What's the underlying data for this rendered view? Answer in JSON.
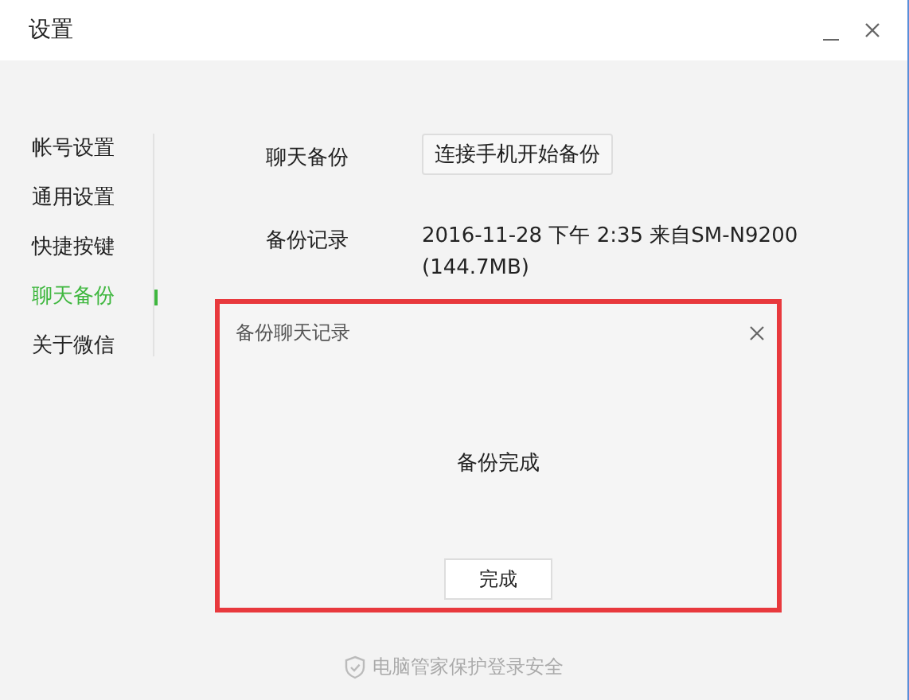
{
  "window": {
    "title": "设置"
  },
  "sidebar": {
    "items": [
      {
        "label": "帐号设置",
        "selected": false
      },
      {
        "label": "通用设置",
        "selected": false
      },
      {
        "label": "快捷按键",
        "selected": false
      },
      {
        "label": "聊天备份",
        "selected": true
      },
      {
        "label": "关于微信",
        "selected": false
      }
    ]
  },
  "settings": [
    {
      "kind": "button",
      "label": "聊天备份",
      "value": "连接手机开始备份"
    },
    {
      "kind": "text",
      "label": "备份记录",
      "value": "2016-11-28 下午 2:35 来自SM-N9200",
      "detail": "(144.7MB)"
    }
  ],
  "dialog": {
    "title": "备份聊天记录",
    "message": "备份完成",
    "button": "完成",
    "highlighted": true
  },
  "footer": {
    "text": "电脑管家保护登录安全"
  }
}
